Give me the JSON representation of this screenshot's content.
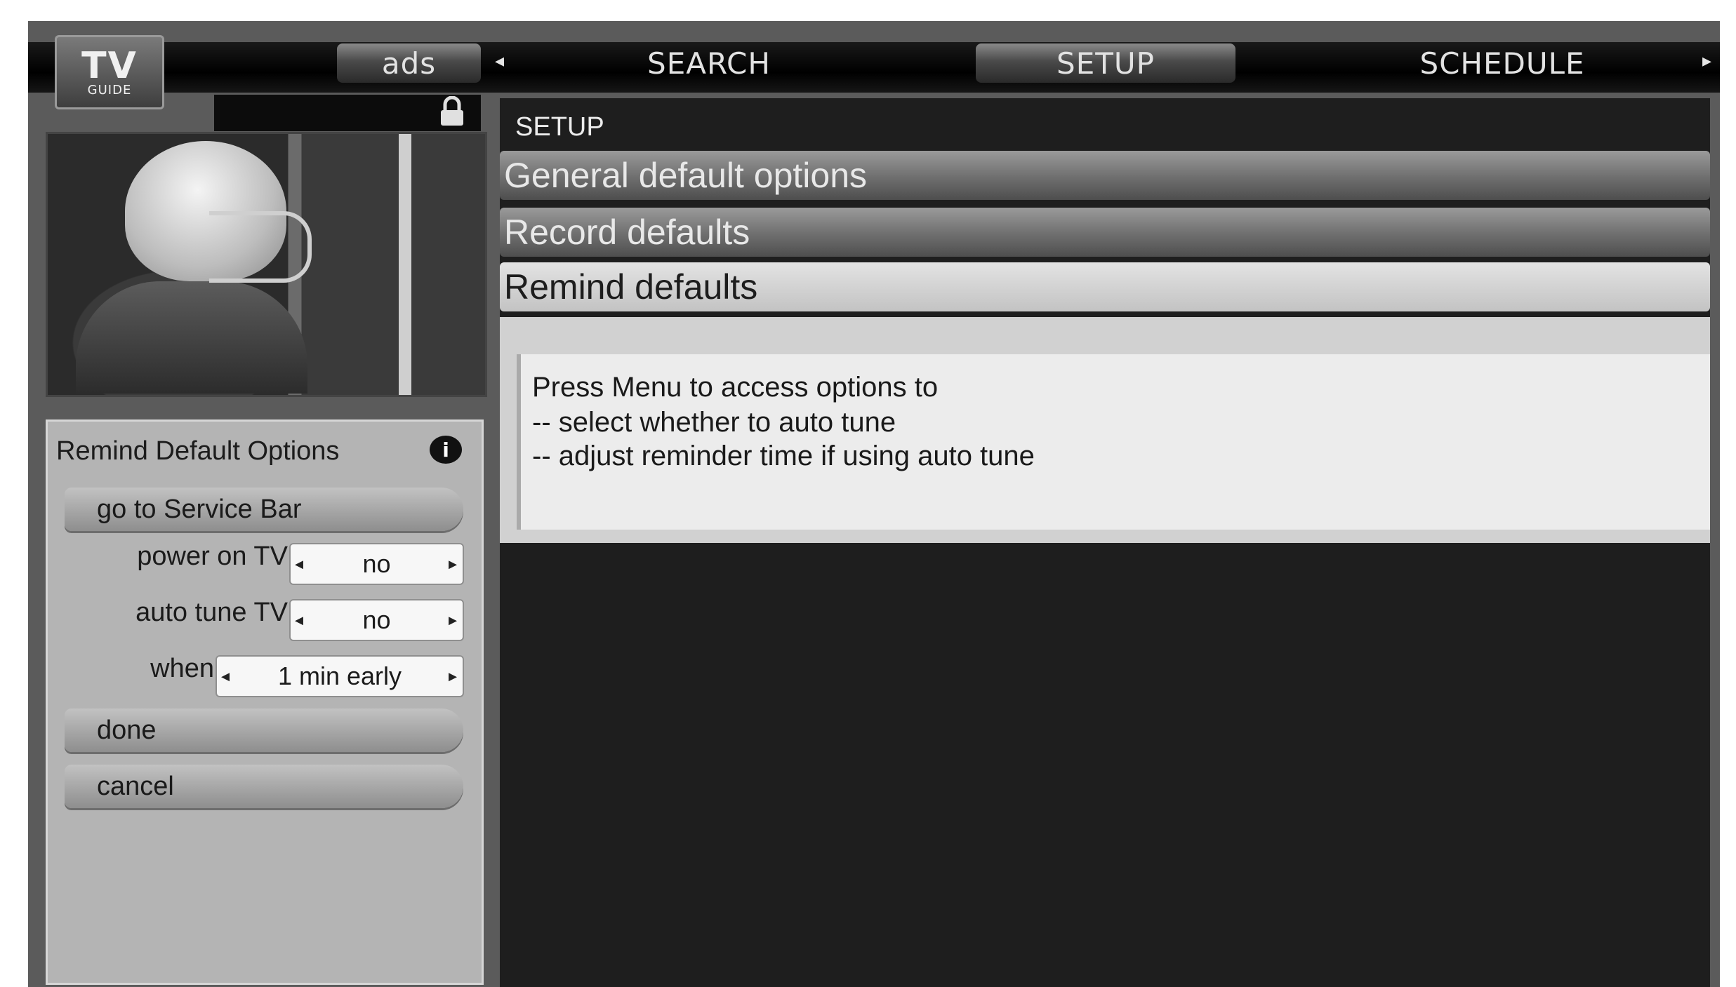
{
  "logo": {
    "line1": "TV",
    "line2": "GUIDE"
  },
  "nav": {
    "items": [
      "ads",
      "SEARCH",
      "SETUP",
      "SCHEDULE"
    ],
    "active": "SETUP"
  },
  "side_panel": {
    "title": "Remind Default Options",
    "service_bar_label": "go to Service Bar",
    "options": [
      {
        "label": "power on TV",
        "value": "no"
      },
      {
        "label": "auto tune TV",
        "value": "no"
      },
      {
        "label": "when",
        "value": "1 min early"
      }
    ],
    "done_label": "done",
    "cancel_label": "cancel"
  },
  "main": {
    "title": "SETUP",
    "menu": [
      "General default options",
      "Record defaults",
      "Remind defaults"
    ],
    "selected_index": 2,
    "description": [
      "Press Menu to access options to",
      "-- select whether to auto tune",
      "-- adjust reminder time if using auto tune"
    ]
  },
  "icons": [
    "lock-icon",
    "info-icon",
    "left-arrow-icon",
    "right-arrow-icon"
  ]
}
